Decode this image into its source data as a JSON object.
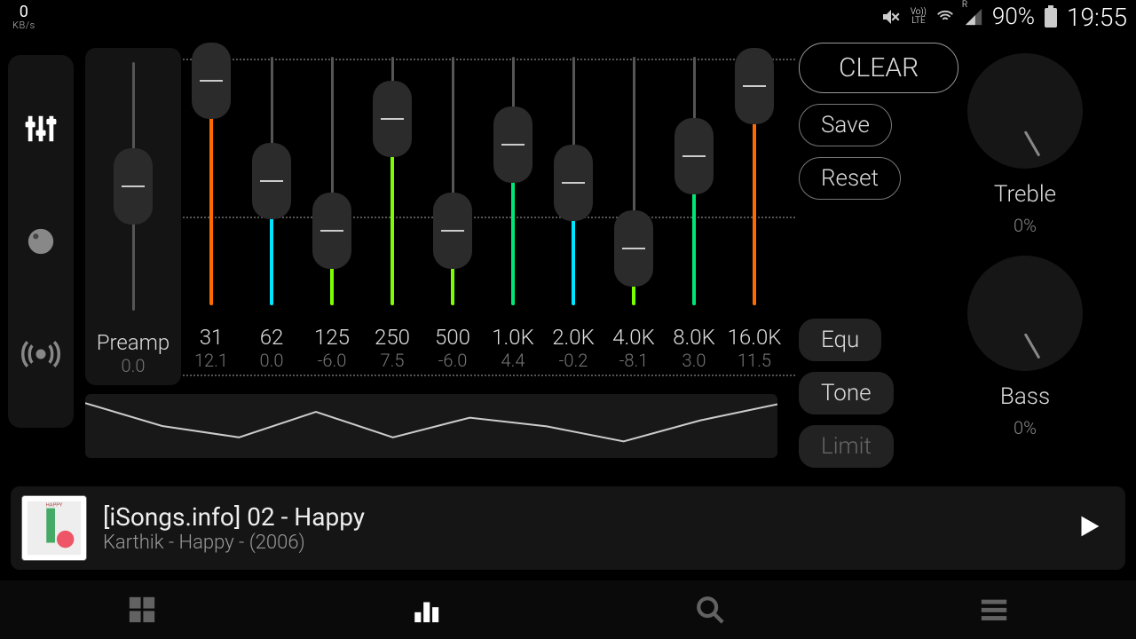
{
  "status": {
    "speed_value": "0",
    "speed_unit": "KB/s",
    "volte": "Vo))\nLTE",
    "roaming": "R",
    "battery_pct": "90%",
    "time": "19:55"
  },
  "tabs": {
    "eq_icon": "equalizer-icon",
    "balance_icon": "balance-knob-icon",
    "surround_icon": "surround-icon"
  },
  "preamp": {
    "label": "Preamp",
    "value": "0.0"
  },
  "bands": [
    {
      "freq": "31",
      "value": "12.1",
      "num": 12.1
    },
    {
      "freq": "62",
      "value": "0.0",
      "num": 0.0
    },
    {
      "freq": "125",
      "value": "-6.0",
      "num": -6.0
    },
    {
      "freq": "250",
      "value": "7.5",
      "num": 7.5
    },
    {
      "freq": "500",
      "value": "-6.0",
      "num": -6.0
    },
    {
      "freq": "1.0K",
      "value": "4.4",
      "num": 4.4
    },
    {
      "freq": "2.0K",
      "value": "-0.2",
      "num": -0.2
    },
    {
      "freq": "4.0K",
      "value": "-8.1",
      "num": -8.1
    },
    {
      "freq": "8.0K",
      "value": "3.0",
      "num": 3.0
    },
    {
      "freq": "16.0K",
      "value": "11.5",
      "num": 11.5
    }
  ],
  "buttons": {
    "clear": "CLEAR",
    "save": "Save",
    "reset": "Reset",
    "equ": "Equ",
    "tone": "Tone",
    "limit": "Limit"
  },
  "knobs": {
    "treble_label": "Treble",
    "treble_value": "0%",
    "bass_label": "Bass",
    "bass_value": "0%"
  },
  "nowplaying": {
    "title": "[iSongs.info] 02 - Happy",
    "subtitle": "Karthik - Happy - (2006)"
  },
  "chart_data": {
    "type": "line",
    "title": "EQ frequency response",
    "x_freq_hz": [
      31,
      62,
      125,
      250,
      500,
      1000,
      2000,
      4000,
      8000,
      16000
    ],
    "y_gain_db": [
      12.1,
      0.0,
      -6.0,
      7.5,
      -6.0,
      4.4,
      -0.2,
      -8.1,
      3.0,
      11.5
    ],
    "ylim": [
      -15,
      15
    ]
  },
  "colors": {
    "scale": [
      "#ff3333",
      "#ff6a00",
      "#ffd500",
      "#c8ff00",
      "#63ff00",
      "#00ffb0",
      "#00e5ff",
      "#00aaff"
    ]
  }
}
